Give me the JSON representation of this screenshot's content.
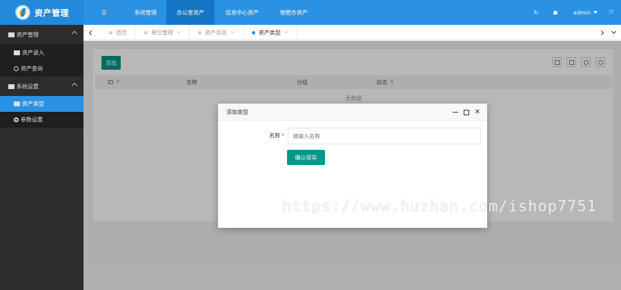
{
  "app": {
    "title": "资产管理"
  },
  "topnav": {
    "home_label": "☰",
    "items": [
      {
        "label": "系统管理"
      },
      {
        "label": "办公室资产"
      },
      {
        "label": "信息中心资产"
      },
      {
        "label": "物管办资产"
      }
    ],
    "refresh_icon": "↻",
    "theme_icon": "☗",
    "user": "admin",
    "fullscreen_icon": "⤧"
  },
  "sidebar": {
    "groups": [
      {
        "label": "资产管理",
        "items": [
          {
            "label": "资产录入"
          },
          {
            "label": "资产查询"
          }
        ]
      },
      {
        "label": "系统设置",
        "items": [
          {
            "label": "资产类型"
          },
          {
            "label": "参数设置"
          }
        ]
      }
    ]
  },
  "tabs": {
    "items": [
      {
        "label": "首页"
      },
      {
        "label": "单位管理",
        "close": "×"
      },
      {
        "label": "资产状态",
        "close": "×"
      },
      {
        "label": "资产类型",
        "close": "×"
      }
    ]
  },
  "toolbar": {
    "add_label": "添加"
  },
  "table": {
    "columns": [
      "ID",
      "名称",
      "分组",
      "状态"
    ],
    "sort_glyph": "⬍",
    "empty_text": "无数据"
  },
  "modal": {
    "title": "添加类型",
    "min_icon": "—",
    "close_icon": "✕",
    "name_label": "名称",
    "required_mark": "*",
    "name_placeholder": "请输入名称",
    "name_value": "",
    "confirm_label": "确认保存"
  },
  "watermark": "https://www.huzhan.com/ishop7751",
  "colors": {
    "topbar": "#2b91e3",
    "nav_active": "#1576c5",
    "sidebar": "#2c2c2c",
    "sidebar_active": "#2b91e3",
    "primary_button": "#009688"
  }
}
